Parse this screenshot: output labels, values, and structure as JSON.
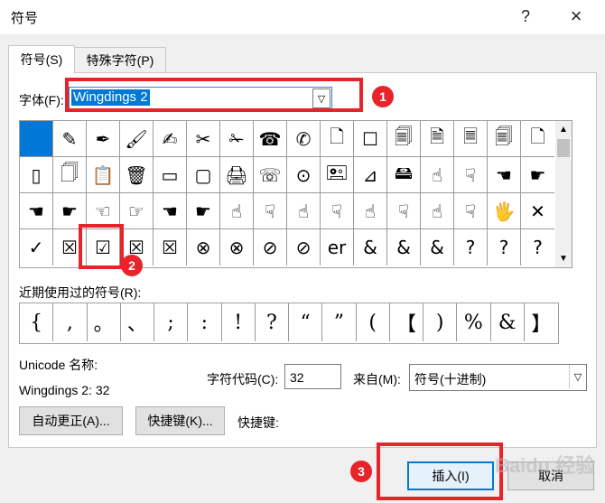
{
  "window": {
    "title": "符号",
    "help": "?",
    "close": "×"
  },
  "tabs": [
    {
      "label": "符号(S)"
    },
    {
      "label": "特殊字符(P)"
    }
  ],
  "font": {
    "label": "字体(F):",
    "value": "Wingdings 2"
  },
  "symbols": [
    [
      "",
      "✎",
      "✒",
      "🖌",
      "✍",
      "✂",
      "✁",
      "☎",
      "✆",
      "🗋",
      "☐",
      "🗐",
      "🗎",
      "🗏",
      "🗐",
      "🗋"
    ],
    [
      "▯",
      "🗍",
      "📋",
      "🗑",
      "▭",
      "▢",
      "🖨",
      "☏",
      "⊙",
      "🖭",
      "⊿",
      "🖴",
      "☝",
      "☟",
      "☚",
      "☛"
    ],
    [
      "☚",
      "☛",
      "☜",
      "☞",
      "☚",
      "☛",
      "☝",
      "☟",
      "☝",
      "☟",
      "☝",
      "☟",
      "☝",
      "☟",
      "🖐",
      "✕"
    ],
    [
      "✓",
      "☒",
      "☑",
      "☒",
      "☒",
      "⊗",
      "⊗",
      "⊘",
      "⊘",
      "er",
      "&",
      "&",
      "&",
      "?",
      "?",
      "?"
    ]
  ],
  "symbols_selected": {
    "row": 0,
    "col": 0
  },
  "recent": {
    "label": "近期使用过的符号(R):",
    "items": [
      "{",
      ",",
      "。",
      "、",
      ";",
      ":",
      "!",
      "?",
      "“",
      "”",
      "(",
      "【",
      ")",
      "%",
      "&",
      "】"
    ]
  },
  "unicode": {
    "label": "Unicode 名称:",
    "value": "Wingdings 2: 32"
  },
  "charcode": {
    "label": "字符代码(C):",
    "value": "32"
  },
  "from": {
    "label": "来自(M):",
    "value": "符号(十进制)"
  },
  "buttons": {
    "autocorrect": "自动更正(A)...",
    "shortcut_key": "快捷键(K)...",
    "shortcut_label": "快捷键:",
    "insert": "插入(I)",
    "cancel": "取消"
  },
  "annotations": [
    "1",
    "2",
    "3"
  ],
  "watermark": "Baidu 经验",
  "colors": {
    "selection": "#0078d7",
    "annotation": "#e8232a"
  }
}
